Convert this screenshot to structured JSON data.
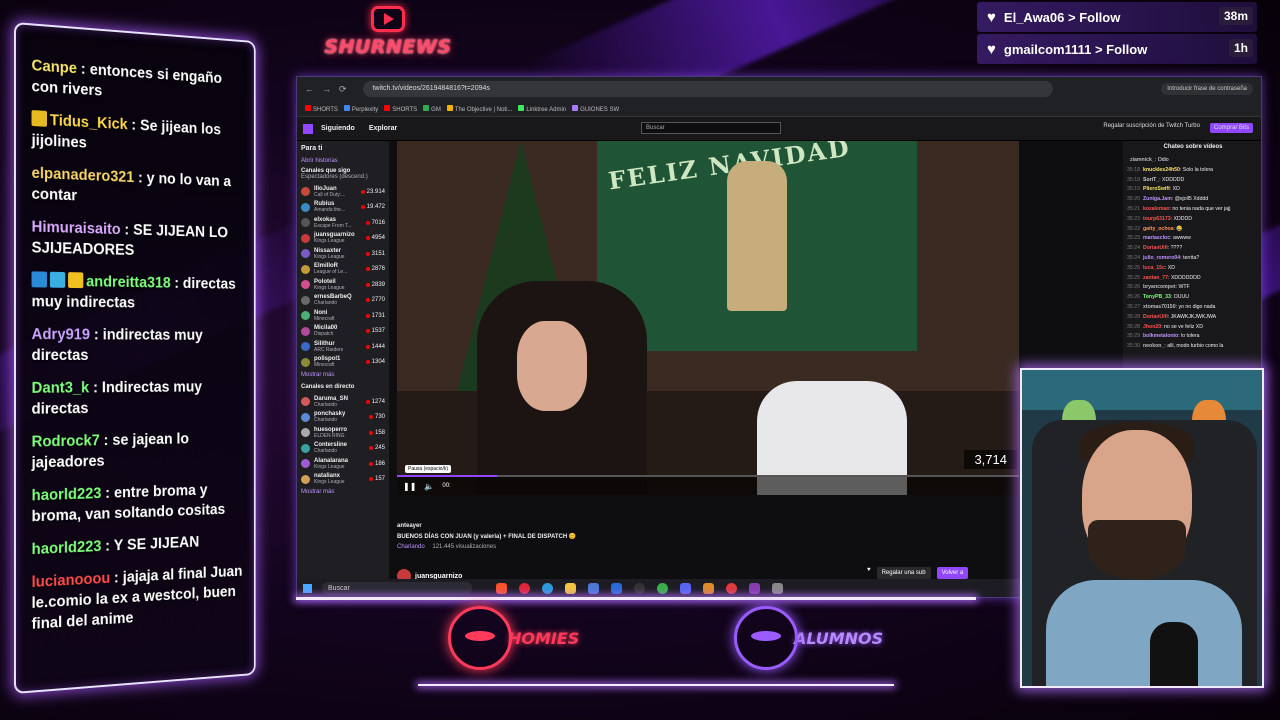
{
  "brand": {
    "name": "SHURNEWS",
    "accent": "#ff2e4f"
  },
  "overlay_chat": [
    {
      "user": "Canpe",
      "text": ": entonces si engaño con rivers",
      "color": "#f7e26b",
      "badge": ""
    },
    {
      "user": "Tidus_Kick",
      "text": ": Se jijean los jijolines",
      "color": "#ffd84a",
      "badge": "crown"
    },
    {
      "user": "elpanadero321",
      "text": ": y no lo van a contar",
      "color": "#f7d36b",
      "badge": ""
    },
    {
      "user": "Himuraisaito",
      "text": ": SE JIJEAN LO SJIJEADORES",
      "color": "#d9a8ff",
      "badge": ""
    },
    {
      "user": "andreitta318",
      "text": ": directas muy indirectas",
      "color": "#7dff7a",
      "badge": "multi"
    },
    {
      "user": "Adry919",
      "text": ": indirectas muy directas",
      "color": "#c9a3ff",
      "badge": ""
    },
    {
      "user": "Dant3_k",
      "text": ": Indirectas muy directas",
      "color": "#7dff7a",
      "badge": ""
    },
    {
      "user": "Rodrock7",
      "text": ": se jajean lo jajeadores",
      "color": "#7dff7a",
      "badge": ""
    },
    {
      "user": "haorld223",
      "text": ": entre broma y broma, van soltando cositas",
      "color": "#7dff7a",
      "badge": ""
    },
    {
      "user": "haorld223",
      "text": ": Y SE JIJEAN",
      "color": "#7dff7a",
      "badge": ""
    },
    {
      "user": "lucianooou",
      "text": ": jajaja al final Juan le.comio la ex a westcol, buen final del anime",
      "color": "#ff4a4a",
      "badge": ""
    }
  ],
  "follows": [
    {
      "text": "El_Awa06 > Follow",
      "age": "38m"
    },
    {
      "text": "gmailcom1111 > Follow",
      "age": "1h"
    }
  ],
  "browser": {
    "url": "twitch.tv/videos/2619484816?t=2094s",
    "password_btn": "Introducir frase de contraseña",
    "bookmarks": [
      "SHORTS",
      "Perplexity",
      "SHORTS",
      "GM",
      "The Objective | Noti...",
      "Linktree Admin",
      "GUIONES SW"
    ]
  },
  "twitch": {
    "nav": [
      "Siguiendo",
      "Explorar"
    ],
    "search_placeholder": "Buscar",
    "turbo": "Regalar suscripción de Twitch Turbo",
    "bits": "Comprar Bits",
    "sidebar_title": "Para ti",
    "history": "Abrir historias",
    "followed_header": "Canales que sigo",
    "followed_sub": "Espectadores (descend.)",
    "followed": [
      {
        "name": "IlloJuan",
        "game": "Call of Duty:...",
        "viewers": "23.914",
        "color": "#c54a3a"
      },
      {
        "name": "Rubius",
        "game": "Amanda the...",
        "viewers": "19.472",
        "color": "#3a8ac5"
      },
      {
        "name": "elxokas",
        "game": "Escape From T...",
        "viewers": "7016",
        "color": "#555"
      },
      {
        "name": "juansguarnizo",
        "game": "Kings League",
        "viewers": "4954",
        "color": "#c73b3b"
      },
      {
        "name": "Nissaxter",
        "game": "Kings League",
        "viewers": "3151",
        "color": "#7a5bc5"
      },
      {
        "name": "ElmilloR",
        "game": "League of Le...",
        "viewers": "2876",
        "color": "#c59a3a"
      },
      {
        "name": "Poloteil",
        "game": "Kings League",
        "viewers": "2839",
        "color": "#d34f8a"
      },
      {
        "name": "ernesBarbeQ",
        "game": "Charlando",
        "viewers": "2770",
        "color": "#6a6a6a"
      },
      {
        "name": "Noni",
        "game": "Minecraft",
        "viewers": "1731",
        "color": "#4ab07a"
      },
      {
        "name": "Micila00",
        "game": "Dispatch",
        "viewers": "1537",
        "color": "#b04a9a"
      },
      {
        "name": "Silithur",
        "game": "ARC Raiders",
        "viewers": "1444",
        "color": "#3a6ac5"
      },
      {
        "name": "polispol1",
        "game": "Minecraft",
        "viewers": "1304",
        "color": "#8a8a3a"
      }
    ],
    "show_more": "Mostrar más",
    "live_header": "Canales en directo",
    "live": [
      {
        "name": "Daruma_SN",
        "game": "Charlando",
        "viewers": "1274",
        "color": "#d35a5a"
      },
      {
        "name": "ponchasky",
        "game": "Charlando",
        "viewers": "730",
        "color": "#5a8ad3"
      },
      {
        "name": "huesoperro",
        "game": "ELDEN RING",
        "viewers": "158",
        "color": "#aaa"
      },
      {
        "name": "Contersline",
        "game": "Charlando",
        "viewers": "245",
        "color": "#3aa0a0"
      },
      {
        "name": "Alanalarana",
        "game": "Kings League",
        "viewers": "186",
        "color": "#a05ad3"
      },
      {
        "name": "natalianx",
        "game": "Kings League",
        "viewers": "157",
        "color": "#d3a05a"
      }
    ],
    "show_more_2": "Mostrar más",
    "video_banner": "FELIZ NAVIDAD",
    "counter": "3,714",
    "progress": 0.16,
    "tooltip": "Pausa (espacio/k)",
    "time": "00:",
    "uploaded": "anteayer",
    "title": "BUENOS DÍAS CON JUAN (y valeria) + FINAL DE DISPATCH 😊",
    "category": "Charlando",
    "views": "121.445 visualizaciones",
    "streamer": "juansguarnizo",
    "gift": "Regalar una sub",
    "sub": "Volver a",
    "chat_header": "Chateo sobre vídeos",
    "chat": [
      {
        "t": "",
        "u": "ziamnick_",
        "m": ": Odio",
        "c": "#bbb"
      },
      {
        "t": "35:18",
        "u": "knuckles24h50",
        "m": ": Solo la tolera",
        "c": "#f7e26b"
      },
      {
        "t": "35:19",
        "u": "SoriT_",
        "m": ": XDDDDD",
        "c": "#d0d0d0"
      },
      {
        "t": "35:19",
        "u": "PlieroSwift",
        "m": ": XD",
        "c": "#f7e26b"
      },
      {
        "t": "35:20",
        "u": "Zuniga.Jam",
        "m": ": @sjoll5 Xdddd",
        "c": "#bf94ff"
      },
      {
        "t": "35:21",
        "u": "kozaleman",
        "m": ": no tenia nada que ver jajj",
        "c": "#ff5050"
      },
      {
        "t": "35:22",
        "u": "tourp63173",
        "m": ": XDDDD",
        "c": "#ff5050"
      },
      {
        "t": "35:22",
        "u": "gatty_ochoa",
        "m": ": 😂",
        "c": "#ff9050"
      },
      {
        "t": "35:23",
        "u": "mariascloc",
        "m": ": awwww",
        "c": "#bf94ff"
      },
      {
        "t": "35:24",
        "u": "DorianUifi",
        "m": ": ????",
        "c": "#ff5050"
      },
      {
        "t": "35:24",
        "u": "julio_romero04",
        "m": ": territa?",
        "c": "#bf94ff"
      },
      {
        "t": "35:25",
        "u": "luca_15c",
        "m": ": XD",
        "c": "#ff5050"
      },
      {
        "t": "35:25",
        "u": "zantan_77",
        "m": ": XDDDDDDD",
        "c": "#ff5050"
      },
      {
        "t": "35:26",
        "u": "bryancompet",
        "m": ": WTF",
        "c": "#bbb"
      },
      {
        "t": "35:26",
        "u": "TonyPB_33",
        "m": ": OUUU",
        "c": "#7dff7a"
      },
      {
        "t": "35:27",
        "u": "xtomas70150",
        "m": ": yo no digo nada",
        "c": "#bbb"
      },
      {
        "t": "35:28",
        "u": "DorianUifi",
        "m": ": JKAWKJKJWKJWA",
        "c": "#ff5050"
      },
      {
        "t": "35:28",
        "u": "Jhon20",
        "m": ": no se ve feliz XD",
        "c": "#ff5050"
      },
      {
        "t": "35:29",
        "u": "bolkmetalonio",
        "m": ": lo tolera",
        "c": "#bf94ff"
      },
      {
        "t": "35:30",
        "u": "neokon_",
        "m": ": alli, modo turbio como la",
        "c": "#bbb"
      }
    ],
    "taskbar_search": "Buscar"
  },
  "teams": [
    {
      "name": "HOMIES",
      "color": "#ff3a5a"
    },
    {
      "name": "ALUMNOS",
      "color": "#9a5cff"
    }
  ]
}
